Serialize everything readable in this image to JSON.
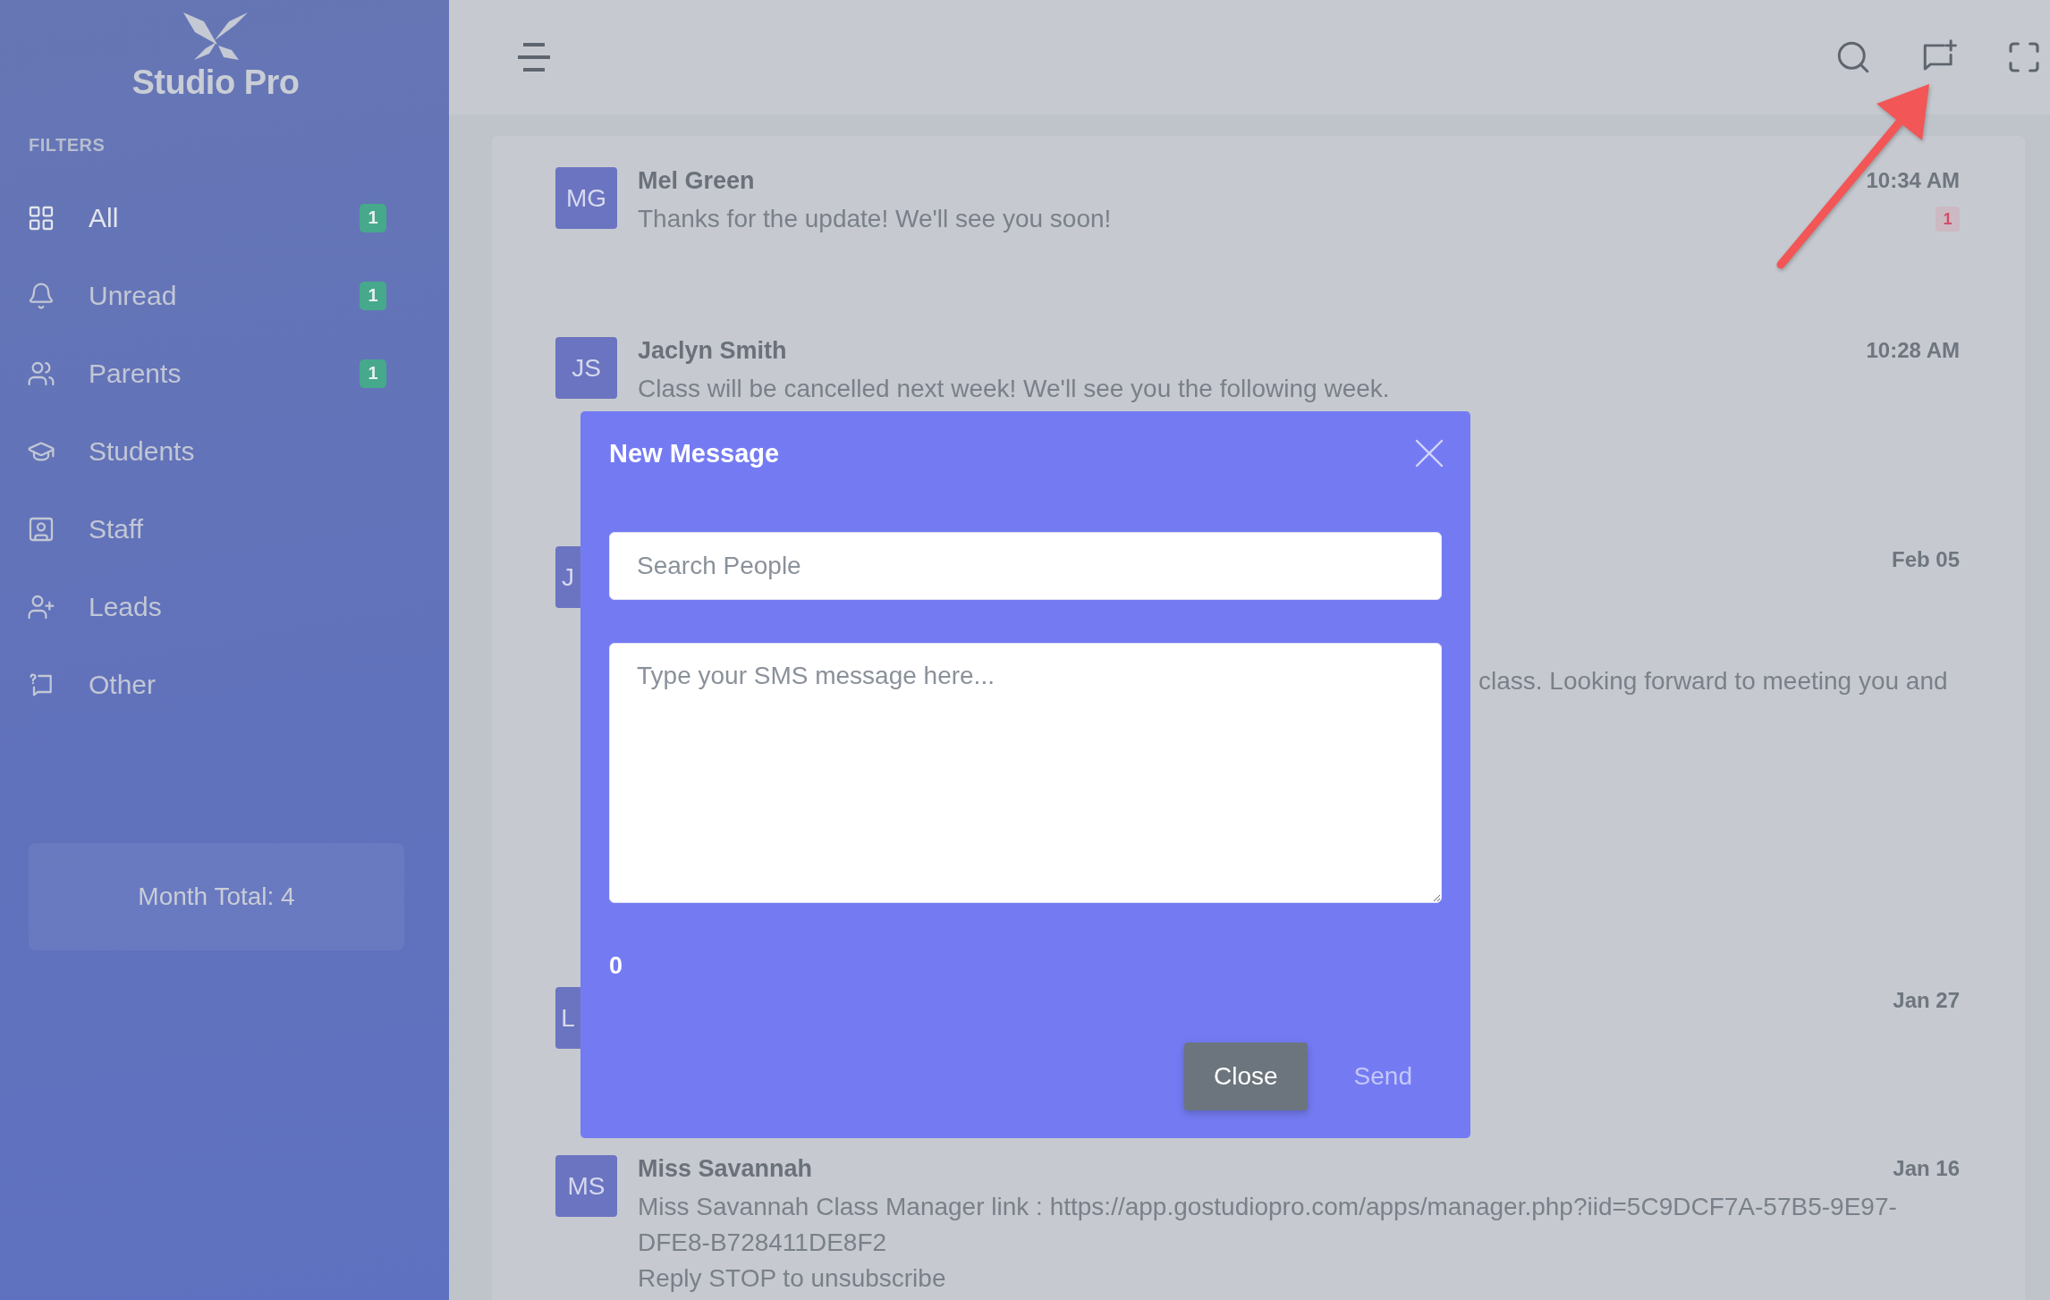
{
  "sidebar": {
    "logo_text": "Studio Pro",
    "section_title": "FILTERS",
    "items": [
      {
        "label": "All",
        "selected": true,
        "badge": "1"
      },
      {
        "label": "Unread",
        "selected": false,
        "badge": "1"
      },
      {
        "label": "Parents",
        "selected": false,
        "badge": "1"
      },
      {
        "label": "Students",
        "selected": false
      },
      {
        "label": "Staff",
        "selected": false
      },
      {
        "label": "Leads",
        "selected": false
      },
      {
        "label": "Other",
        "selected": false
      }
    ],
    "month_total": "Month Total: 4"
  },
  "messages": [
    {
      "kind": "full",
      "initials": "MG",
      "name": "Mel Green",
      "text": "Thanks for the update! We'll see you soon!",
      "time": "10:34 AM",
      "unread": "1"
    },
    {
      "kind": "full",
      "initials": "JS",
      "name": "Jaclyn Smith",
      "text": "Class will be cancelled next week! We'll see you the following week.",
      "time": "10:28 AM"
    },
    {
      "kind": "covered",
      "initials": "J",
      "time": "Feb 05",
      "text": "class. Looking forward to meeting you and"
    },
    {
      "kind": "covered",
      "initials": "L",
      "time": "Jan 27"
    },
    {
      "kind": "full",
      "initials": "MS",
      "name": "Miss Savannah",
      "text": "Miss Savannah Class Manager link : https://app.gostudiopro.com/apps/manager.php?iid=5C9DCF7A-57B5-9E97-DFE8-B728411DE8F2\nReply STOP to unsubscribe",
      "time": "Jan 16"
    }
  ],
  "modal": {
    "title": "New Message",
    "search": {
      "placeholder": "Search People"
    },
    "message": {
      "placeholder": "Type your SMS message here..."
    },
    "char_count": "0",
    "buttons": [
      {
        "label": "Close",
        "kind": "secondary"
      },
      {
        "label": "Send",
        "kind": "link"
      }
    ]
  },
  "annotations": [
    {
      "kind": "arrow"
    }
  ]
}
